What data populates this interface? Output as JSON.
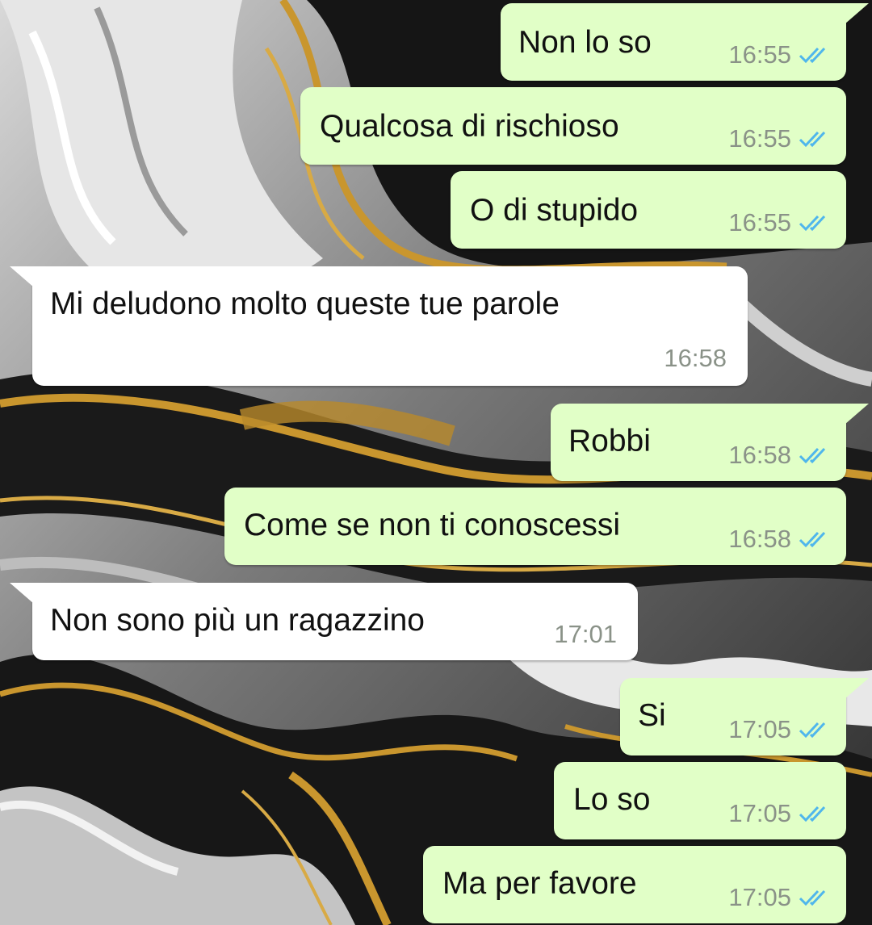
{
  "chat": {
    "messages": [
      {
        "direction": "out",
        "text": "Non lo so",
        "time": "16:55",
        "status": "read-double-check-icon"
      },
      {
        "direction": "out",
        "text": "Qualcosa di rischioso",
        "time": "16:55",
        "status": "read-double-check-icon"
      },
      {
        "direction": "out",
        "text": "O di stupido",
        "time": "16:55",
        "status": "read-double-check-icon"
      },
      {
        "direction": "in",
        "text": "Mi deludono molto queste tue parole",
        "time": "16:58"
      },
      {
        "direction": "out",
        "text": "Robbi",
        "time": "16:58",
        "status": "read-double-check-icon"
      },
      {
        "direction": "out",
        "text": "Come se non ti conoscessi",
        "time": "16:58",
        "status": "read-double-check-icon"
      },
      {
        "direction": "in",
        "text": "Non sono più un ragazzino",
        "time": "17:01"
      },
      {
        "direction": "out",
        "text": "Si",
        "time": "17:05",
        "status": "read-double-check-icon"
      },
      {
        "direction": "out",
        "text": "Lo so",
        "time": "17:05",
        "status": "read-double-check-icon"
      },
      {
        "direction": "out",
        "text": "Ma per favore",
        "time": "17:05",
        "status": "read-double-check-icon"
      }
    ]
  },
  "colors": {
    "outgoing_bubble": "#e1ffc7",
    "incoming_bubble": "#ffffff",
    "read_tick": "#4fb6ec",
    "wallpaper_gold": "#c9962e",
    "wallpaper_black": "#141414",
    "wallpaper_silver": "#cfcfcf"
  }
}
